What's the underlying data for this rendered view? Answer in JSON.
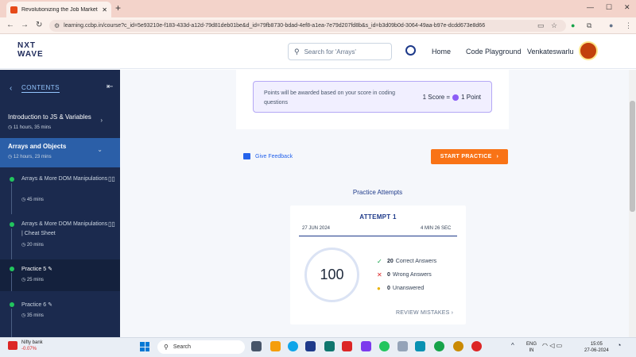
{
  "browser": {
    "tab_title": "Revolutionizing the Job Market",
    "url": "learning.ccbp.in/course?c_id=5e93210e-f183-433d-a12d-79d81deb01be&d_id=79fb8730-bdad-4ef8-a1ea-7e79d207fd8b&s_id=b3d09b0d-3064-49aa-b97e-dcdd673e8d66"
  },
  "header": {
    "logo_line1": "NXT",
    "logo_line2": "WAVE",
    "search_placeholder": "Search for 'Arrays'",
    "nav_home": "Home",
    "nav_playground": "Code Playground",
    "username": "Venkateswarlu"
  },
  "sidebar": {
    "title": "CONTENTS",
    "sections": [
      {
        "title": "Introduction to JS & Variables",
        "duration": "11 hours, 35 mins"
      },
      {
        "title": "Arrays and Objects",
        "duration": "12 hours, 23 mins"
      }
    ],
    "items": [
      {
        "title": "Arrays & More DOM Manipulations",
        "duration": "45 mins"
      },
      {
        "title": "Arrays & More DOM Manipulations | Cheat Sheet",
        "duration": "20 mins"
      },
      {
        "title": "Practice 5",
        "duration": "25 mins"
      },
      {
        "title": "Practice 6",
        "duration": "35 mins"
      }
    ]
  },
  "points": {
    "text": "Points will be awarded based on your score in coding questions",
    "score_label": "1 Score =",
    "point_label": "1 Point"
  },
  "feedback_label": "Give Feedback",
  "start_label": "START PRACTICE",
  "attempts": {
    "heading": "Practice Attempts",
    "title": "ATTEMPT 1",
    "date": "27 JUN 2024",
    "time": "4 MIN 26 SEC",
    "score": "100",
    "correct_count": "20",
    "correct_label": "Correct Answers",
    "wrong_count": "0",
    "wrong_label": "Wrong Answers",
    "unanswered_count": "0",
    "unanswered_label": "Unanswered",
    "review_label": "REVIEW MISTAKES"
  },
  "taskbar": {
    "widget_title": "Nifty bank",
    "widget_value": "-0.07%",
    "search_label": "Search",
    "lang_line1": "ENG",
    "lang_line2": "IN",
    "time": "15:05",
    "date": "27-06-2024"
  },
  "colors": {
    "sidebar_bg": "#1b2a4e",
    "active_section": "#2b5fa8",
    "primary_button": "#f97316",
    "accent_blue": "#1e3a8a"
  },
  "icons": [
    "search-icon",
    "streak-icon",
    "avatar",
    "back-arrow-icon",
    "collapse-icon",
    "chevron-right-icon",
    "chevron-down-icon",
    "book-icon",
    "edit-icon",
    "check-icon",
    "cross-icon",
    "dot-icon",
    "feedback-icon"
  ]
}
